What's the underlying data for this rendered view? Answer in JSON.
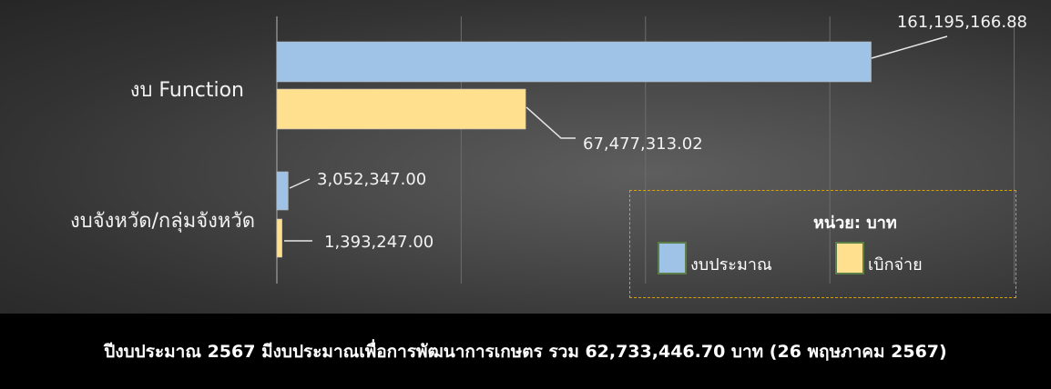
{
  "chart_data": {
    "type": "bar",
    "orientation": "horizontal",
    "categories": [
      "งบ Function",
      "งบจังหวัด/กลุ่มจังหวัด"
    ],
    "series": [
      {
        "name": "งบประมาณ",
        "color": "#9fc3e7",
        "values": [
          161195166.88,
          3052347.0
        ]
      },
      {
        "name": "เบิกจ่าย",
        "color": "#ffe08f",
        "values": [
          67477313.02,
          1393247.0
        ]
      }
    ],
    "data_labels": [
      [
        "161,195,166.88",
        "3,052,347.00"
      ],
      [
        "67,477,313.02",
        "1,393,247.00"
      ]
    ],
    "xlim": [
      0,
      200000000
    ],
    "grid": true,
    "legend_position": "bottom-right",
    "legend_unit": "หน่วย: บาท"
  },
  "footer": {
    "text": "ปีงบประมาณ 2567 มีงบประมาณเพื่อการพัฒนาการเกษตร รวม 62,733,446.70 บาท (26 พฤษภาคม 2567)"
  },
  "colors": {
    "background_light": "#5e5e5e",
    "background_dark": "#262626",
    "legend_border": "#d9a100",
    "footer_bg": "#000000"
  }
}
